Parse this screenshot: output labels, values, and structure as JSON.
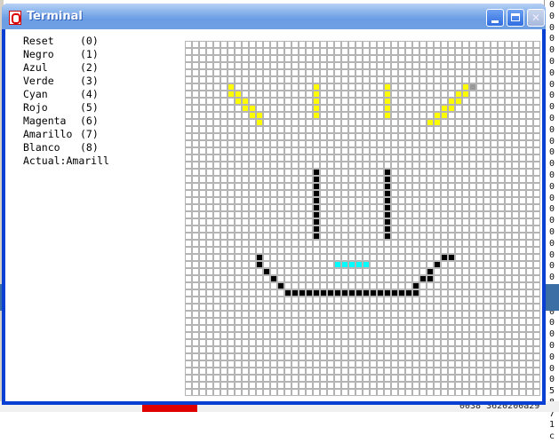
{
  "window": {
    "title": "Terminal",
    "minimize_glyph": "_",
    "maximize_glyph": "□",
    "close_glyph": "✕"
  },
  "menu": {
    "items": [
      {
        "name": "Reset",
        "code": "(0)"
      },
      {
        "name": "Negro",
        "code": "(1)"
      },
      {
        "name": "Azul",
        "code": "(2)"
      },
      {
        "name": "Verde",
        "code": "(3)"
      },
      {
        "name": "Cyan",
        "code": "(4)"
      },
      {
        "name": "Rojo",
        "code": "(5)"
      },
      {
        "name": "Magenta",
        "code": "(6)"
      },
      {
        "name": "Amarillo",
        "code": "(7)"
      },
      {
        "name": "Blanco",
        "code": "(8)"
      }
    ],
    "actual_label": "Actual:",
    "actual_value": "Amarill"
  },
  "canvas": {
    "columns": 50,
    "rows": 50,
    "colors": {
      "grid_line": "#b4b4b4",
      "yellow": "#ffff00",
      "black": "#000000",
      "cyan": "#00ffff",
      "gray": "#999999"
    },
    "cells": {
      "yellow": [
        [
          6,
          6
        ],
        [
          7,
          7
        ],
        [
          8,
          8
        ],
        [
          9,
          9
        ],
        [
          10,
          10
        ],
        [
          6,
          7
        ],
        [
          7,
          8
        ],
        [
          8,
          9
        ],
        [
          9,
          10
        ],
        [
          10,
          11
        ],
        [
          18,
          6
        ],
        [
          18,
          7
        ],
        [
          18,
          8
        ],
        [
          18,
          9
        ],
        [
          18,
          10
        ],
        [
          28,
          6
        ],
        [
          28,
          7
        ],
        [
          28,
          8
        ],
        [
          28,
          9
        ],
        [
          28,
          10
        ],
        [
          38,
          7
        ],
        [
          37,
          8
        ],
        [
          36,
          9
        ],
        [
          35,
          10
        ],
        [
          34,
          11
        ],
        [
          39,
          7
        ],
        [
          38,
          8
        ],
        [
          37,
          9
        ],
        [
          36,
          10
        ],
        [
          35,
          11
        ],
        [
          39,
          6
        ]
      ],
      "gray": [
        [
          40,
          6
        ]
      ],
      "black": [
        [
          18,
          18
        ],
        [
          18,
          19
        ],
        [
          18,
          20
        ],
        [
          18,
          21
        ],
        [
          18,
          22
        ],
        [
          18,
          23
        ],
        [
          18,
          24
        ],
        [
          18,
          25
        ],
        [
          18,
          26
        ],
        [
          18,
          27
        ],
        [
          28,
          18
        ],
        [
          28,
          19
        ],
        [
          28,
          20
        ],
        [
          28,
          21
        ],
        [
          28,
          22
        ],
        [
          28,
          23
        ],
        [
          28,
          24
        ],
        [
          28,
          25
        ],
        [
          28,
          26
        ],
        [
          28,
          27
        ],
        [
          10,
          30
        ],
        [
          10,
          31
        ],
        [
          11,
          32
        ],
        [
          12,
          33
        ],
        [
          13,
          34
        ],
        [
          14,
          35
        ],
        [
          15,
          35
        ],
        [
          16,
          35
        ],
        [
          17,
          35
        ],
        [
          18,
          35
        ],
        [
          19,
          35
        ],
        [
          20,
          35
        ],
        [
          21,
          35
        ],
        [
          22,
          35
        ],
        [
          23,
          35
        ],
        [
          24,
          35
        ],
        [
          25,
          35
        ],
        [
          26,
          35
        ],
        [
          27,
          35
        ],
        [
          28,
          35
        ],
        [
          29,
          35
        ],
        [
          30,
          35
        ],
        [
          31,
          35
        ],
        [
          32,
          35
        ],
        [
          32,
          34
        ],
        [
          33,
          33
        ],
        [
          34,
          33
        ],
        [
          34,
          32
        ],
        [
          35,
          31
        ],
        [
          36,
          30
        ],
        [
          37,
          30
        ]
      ],
      "cyan": [
        [
          21,
          31
        ],
        [
          22,
          31
        ],
        [
          23,
          31
        ],
        [
          24,
          31
        ],
        [
          25,
          31
        ]
      ]
    }
  },
  "background": {
    "right_column": [
      "0",
      "0",
      "0",
      "0",
      "0",
      "0",
      "0",
      "0",
      "0",
      "0",
      "0",
      "0",
      "0",
      "0",
      "0",
      "0",
      "0",
      "0",
      "0",
      "0",
      "0",
      "0",
      "0",
      "0",
      "0",
      "0",
      "0",
      "0",
      "0",
      "0",
      "0",
      "0",
      "0",
      "0",
      "5",
      "8",
      "7",
      "1",
      "c"
    ],
    "bottom_text": "0038  3620200a29"
  }
}
